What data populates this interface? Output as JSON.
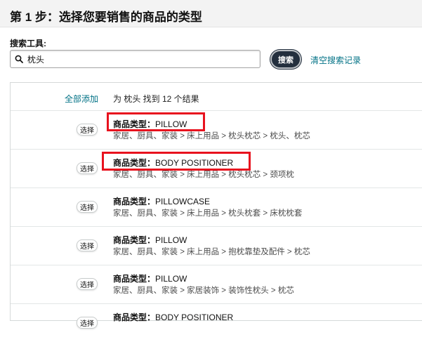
{
  "page": {
    "title": "第 1 步：选择您要销售的商品的类型"
  },
  "search": {
    "label": "搜索工具:",
    "value": "枕头",
    "button_label": "搜索",
    "clear_label": "清空搜索记录"
  },
  "results": {
    "add_all_label": "全部添加",
    "summary": "为 枕头 找到 12 个结果",
    "select_label": "选择",
    "type_label": "商品类型：",
    "items": [
      {
        "type": "PILLOW",
        "path": "家居、厨具、家装 > 床上用品 > 枕头枕芯 > 枕头、枕芯",
        "highlighted": true
      },
      {
        "type": "BODY POSITIONER",
        "path": "家居、厨具、家装 > 床上用品 > 枕头枕芯 > 颈项枕",
        "highlighted": true
      },
      {
        "type": "PILLOWCASE",
        "path": "家居、厨具、家装 > 床上用品 > 枕头枕套 > 床枕枕套",
        "highlighted": false
      },
      {
        "type": "PILLOW",
        "path": "家居、厨具、家装 > 床上用品 > 抱枕靠垫及配件 > 枕芯",
        "highlighted": false
      },
      {
        "type": "PILLOW",
        "path": "家居、厨具、家装 > 家居装饰 > 装饰性枕头 > 枕芯",
        "highlighted": false
      },
      {
        "type": "BODY POSITIONER",
        "path": "",
        "highlighted": false
      }
    ]
  },
  "colors": {
    "link": "#007185",
    "search_button": "#232f3e",
    "highlight": "#e8121e"
  }
}
